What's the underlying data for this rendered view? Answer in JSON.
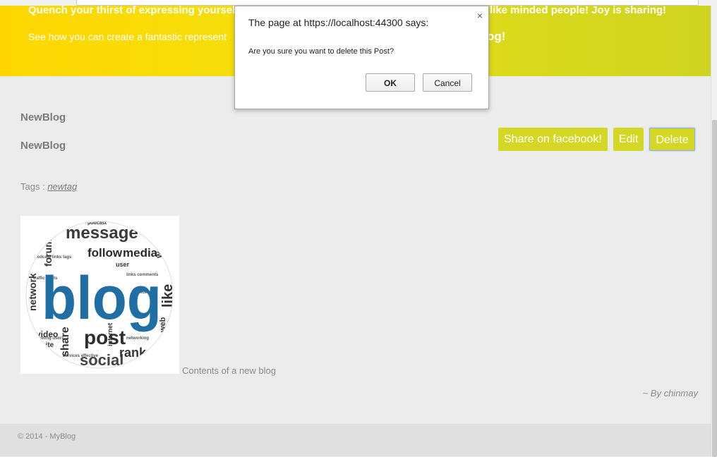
{
  "banner": {
    "line1_left": "Quench your thirst of expressing yourself,",
    "line1_right": "like minded people! Joy is sharing!",
    "line2_left": "See how you can create a fantastic represent",
    "line2_right": "og!"
  },
  "post": {
    "title": "NewBlog",
    "subtitle": "NewBlog",
    "tags_label": "Tags :",
    "tag": "newtag",
    "content": "Contents of a new blog",
    "byline": "~ By chinmay",
    "image_alt": "blog word cloud"
  },
  "buttons": {
    "share": "Share on facebook!",
    "edit": "Edit",
    "delete": "Delete"
  },
  "footer": {
    "text": "© 2014 - MyBlog"
  },
  "dialog": {
    "title": "The page at https://localhost:44300 says:",
    "message": "Are you sure you want to delete this Post?",
    "ok": "OK",
    "cancel": "Cancel",
    "close": "×"
  },
  "wordcloud": {
    "words": [
      "message",
      "follow",
      "media",
      "forum",
      "wall",
      "blog",
      "network",
      "like",
      "post",
      "social",
      "share",
      "rank",
      "video",
      "internet",
      "web",
      "site",
      "podcast",
      "user"
    ]
  },
  "colors": {
    "banner": "#ffd700",
    "button": "#d4d825",
    "blog_blue": "#1f6ea4"
  }
}
